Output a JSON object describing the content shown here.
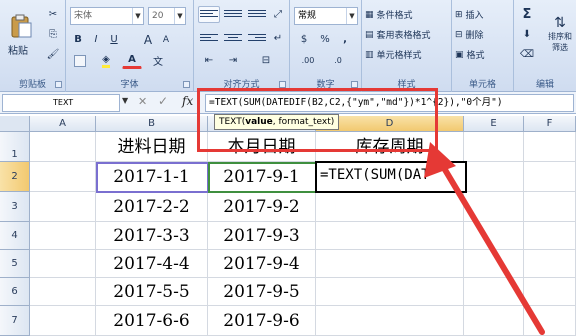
{
  "ribbon": {
    "clipboard": {
      "paste_label": "粘贴",
      "group_label": "剪贴板"
    },
    "font": {
      "font_name": "宋体",
      "font_size": "20",
      "bold": "B",
      "italic": "I",
      "underline": "U",
      "grow": "A",
      "shrink": "A",
      "group_label": "字体",
      "color_a": "A",
      "wen": "文"
    },
    "alignment": {
      "group_label": "对齐方式"
    },
    "number": {
      "format": "常规",
      "group_label": "数字",
      "currency": "$",
      "percent": "%",
      "comma": ",",
      "inc_decimal": ".00",
      "dec_decimal": ".0"
    },
    "styles": {
      "cond_format": "条件格式",
      "table_format": "套用表格格式",
      "cell_style": "单元格样式",
      "group_label": "样式"
    },
    "cells": {
      "insert": "插入",
      "delete": "删除",
      "format": "格式",
      "group_label": "单元格"
    },
    "editing": {
      "sigma": "Σ",
      "sort_filter": "排序和",
      "filter_2": "筛选",
      "group_label": "编辑"
    }
  },
  "formula_bar": {
    "name_box": "TEXT",
    "fx": "fx",
    "formula": "=TEXT(SUM(DATEDIF(B2,C2,{\"ym\",\"md\"})*1^{2}),\"0个月\")",
    "tooltip_fn": "TEXT(",
    "tooltip_arg1": "value",
    "tooltip_rest": ", format_text)"
  },
  "sheet": {
    "columns": [
      "A",
      "B",
      "C",
      "D",
      "E",
      "F"
    ],
    "rows": [
      "1",
      "2",
      "3",
      "4",
      "5",
      "6",
      "7"
    ],
    "headers": {
      "B1": "进料日期",
      "C1": "本月日期",
      "D1": "库存周期"
    },
    "col_b": [
      "2017-1-1",
      "2017-2-2",
      "2017-3-3",
      "2017-4-4",
      "2017-5-5",
      "2017-6-6"
    ],
    "col_c": [
      "2017-9-1",
      "2017-9-2",
      "2017-9-3",
      "2017-9-4",
      "2017-9-5",
      "2017-9-6"
    ],
    "d2_edit": "=TEXT(SUM(DAT"
  },
  "colors": {
    "highlight": "#e53935",
    "selection": "#000000",
    "ribbon": "#dbe5f3"
  }
}
